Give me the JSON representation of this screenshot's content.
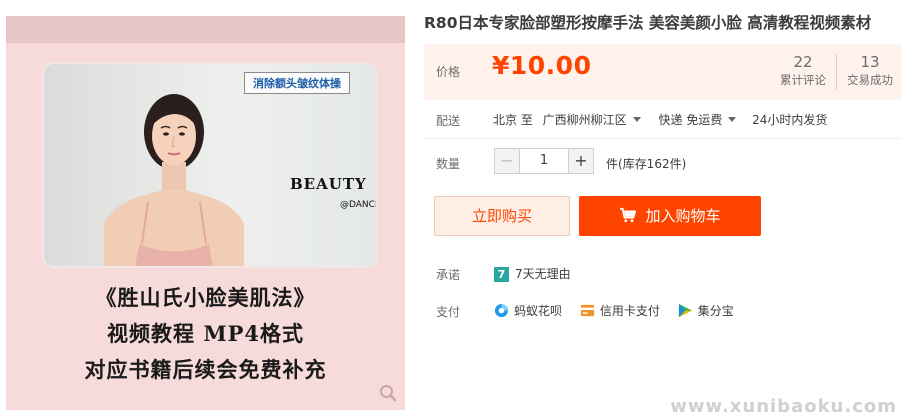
{
  "product": {
    "title": "R80日本专家脸部塑形按摩手法 美容美颜小脸 高清教程视频素材",
    "image": {
      "video_caption": "消除额头皱纹体操",
      "overlay_brand": "BEAUTY",
      "overlay_sub": "@DANCE",
      "promo_lines": [
        "《胜山氏小脸美肌法》",
        "视频教程  MP4格式",
        "对应书籍后续会免费补充"
      ]
    }
  },
  "price": {
    "label": "价格",
    "value": "¥10.00",
    "reviews_count": "22",
    "reviews_label": "累计评论",
    "deals_count": "13",
    "deals_label": "交易成功"
  },
  "delivery": {
    "label": "配送",
    "from": "北京 至",
    "destination": "广西柳州柳江区",
    "shipping": "快递 免运费",
    "dispatch": "24小时内发货"
  },
  "quantity": {
    "label": "数量",
    "value": "1",
    "minus": "−",
    "plus": "+",
    "stock": "件(库存162件)"
  },
  "actions": {
    "buy_now": "立即购买",
    "add_to_cart": "加入购物车"
  },
  "promise": {
    "label": "承诺",
    "badge": "7",
    "text": "7天无理由"
  },
  "payment": {
    "label": "支付",
    "methods": [
      "蚂蚁花呗",
      "信用卡支付",
      "集分宝"
    ]
  },
  "watermark": "www.xunibaoku.com",
  "colors": {
    "accent": "#ff4400",
    "price_bg": "#fff1ec",
    "buy_now_bg": "#ffeee4",
    "promise_badge": "#29a8a0"
  }
}
